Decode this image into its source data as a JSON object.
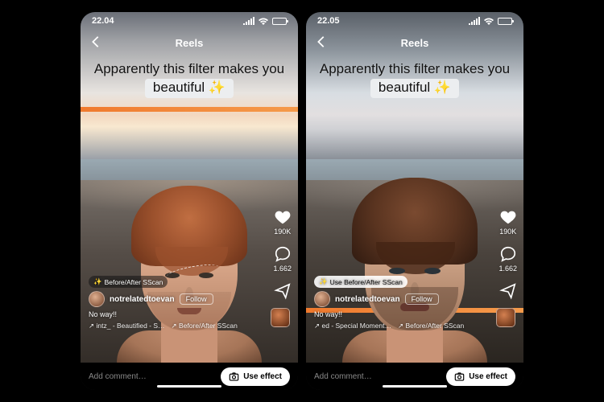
{
  "phones": [
    {
      "status": {
        "time": "22.04"
      },
      "header": {
        "title": "Reels"
      },
      "caption_line1": "Apparently this filter makes you",
      "caption_pill": "beautiful ✨",
      "effect_chip": {
        "label": "Before/After SScan",
        "variant": "dark"
      },
      "orange_bar": "top",
      "face_variant": "v1",
      "user": {
        "name": "notrelatedtoevan",
        "follow": "Follow"
      },
      "caption_text": "No way!!",
      "track_left": "intz_ - Beautified - S…",
      "track_right": "Before/After SScan",
      "likes": "190K",
      "comments": "1.662"
    },
    {
      "status": {
        "time": "22.05"
      },
      "header": {
        "title": "Reels"
      },
      "caption_line1": "Apparently this filter makes you",
      "caption_pill": "beautiful ✨",
      "effect_chip": {
        "label": "Use Before/After SScan",
        "variant": "light"
      },
      "orange_bar": "bottom",
      "face_variant": "v2",
      "user": {
        "name": "notrelatedtoevan",
        "follow": "Follow"
      },
      "caption_text": "No way!!",
      "track_left": "ed - Special Moment…",
      "track_right": "Before/After SScan",
      "likes": "190K",
      "comments": "1.662"
    }
  ],
  "footer": {
    "add_comment_placeholder": "Add comment…",
    "use_effect_label": "Use effect"
  },
  "icons": {
    "sparkle": "✨",
    "music": "♫",
    "arrow": "↗"
  }
}
